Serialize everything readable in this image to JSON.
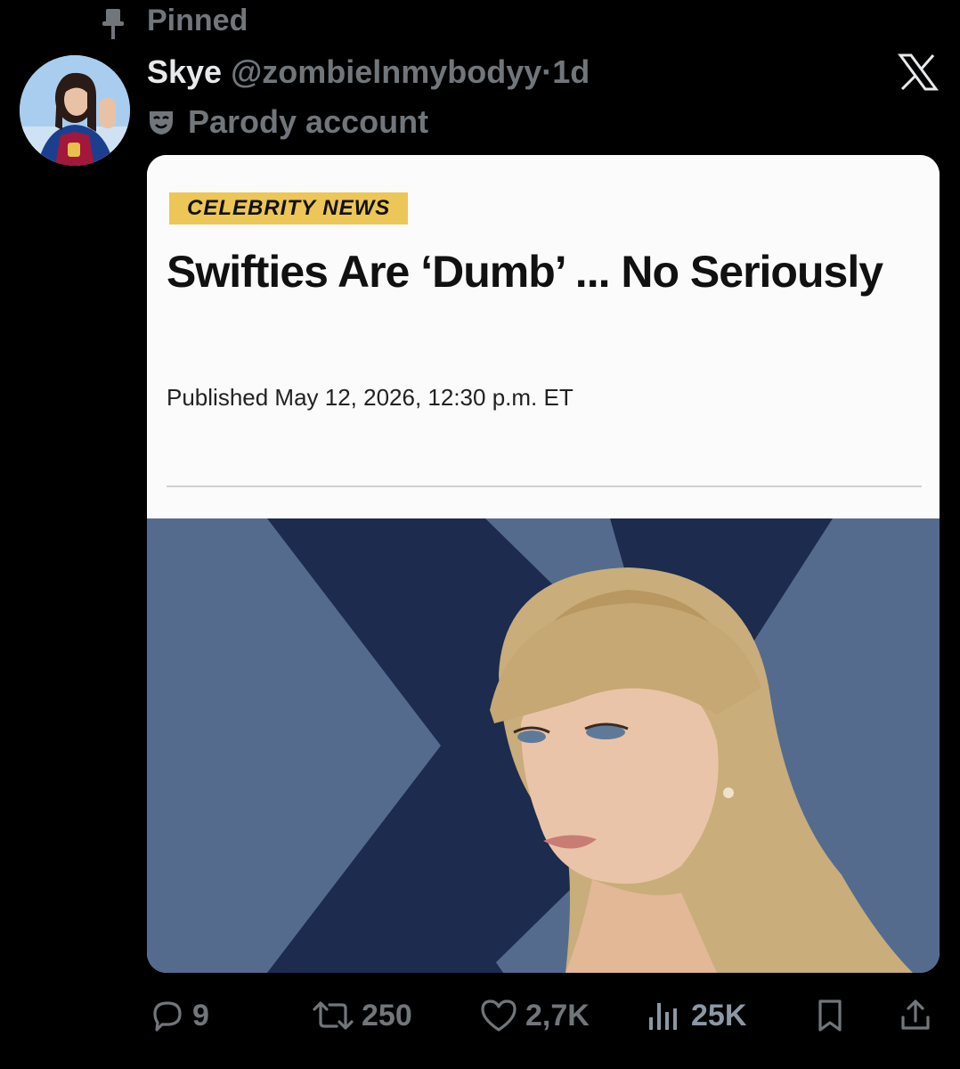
{
  "pinned": {
    "label": "Pinned"
  },
  "post": {
    "display_name": "Skye",
    "handle": "@zombielnmybodyy",
    "separator": "·",
    "time": "1d",
    "account_label": "Parody account",
    "icons": {
      "pin": "pin-icon",
      "mask": "mask-icon",
      "logo": "x-logo"
    }
  },
  "card": {
    "badge": "CELEBRITY NEWS",
    "headline": "Swifties Are ‘Dumb’ ... No Seriously",
    "published": "Published May 12, 2026, 12:30 p.m. ET",
    "colors": {
      "badge": "#ecc656",
      "bg_dark": "#1c2b4e",
      "bg_light": "#546b8e"
    }
  },
  "actions": {
    "replies": "9",
    "reposts": "250",
    "likes": "2,7K",
    "views": "25K"
  },
  "colors": {
    "muted": "#71767b",
    "text": "#e7e9ea",
    "background": "#000000"
  }
}
